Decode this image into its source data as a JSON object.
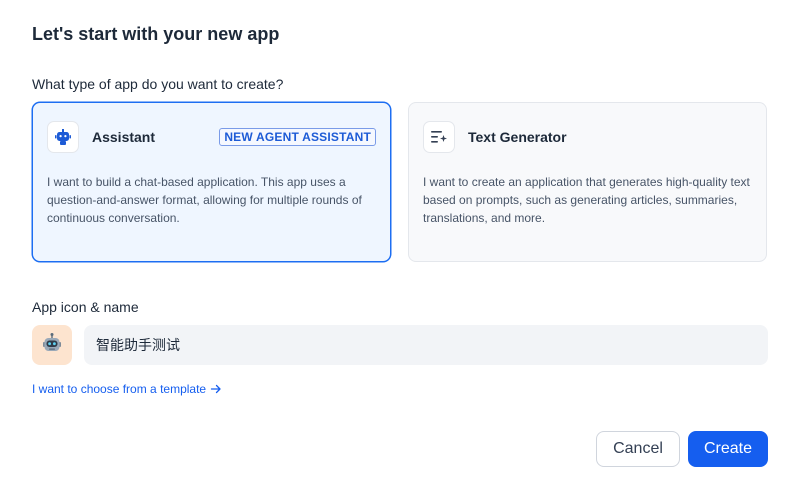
{
  "dialog": {
    "title": "Let's start with your new app",
    "question": "What type of app do you want to create?"
  },
  "app_types": [
    {
      "name": "Assistant",
      "badge": "NEW AGENT ASSISTANT",
      "description": "I want to build a chat-based application. This app uses a question-and-answer format, allowing for multiple rounds of continuous conversation.",
      "icon": "robot-icon",
      "selected": true
    },
    {
      "name": "Text Generator",
      "description": "I want to create an application that generates high-quality text based on prompts, such as generating articles, summaries, translations, and more.",
      "icon": "text-generate-icon",
      "selected": false
    }
  ],
  "app_identity": {
    "label": "App icon & name",
    "icon": "robot-emoji-icon",
    "name_value": "智能助手测试"
  },
  "template_link": "I want to choose from a template",
  "buttons": {
    "cancel": "Cancel",
    "create": "Create"
  },
  "colors": {
    "accent": "#155eef",
    "selected_bg": "#eff6ff",
    "icon_bg": "#fde4cf"
  }
}
